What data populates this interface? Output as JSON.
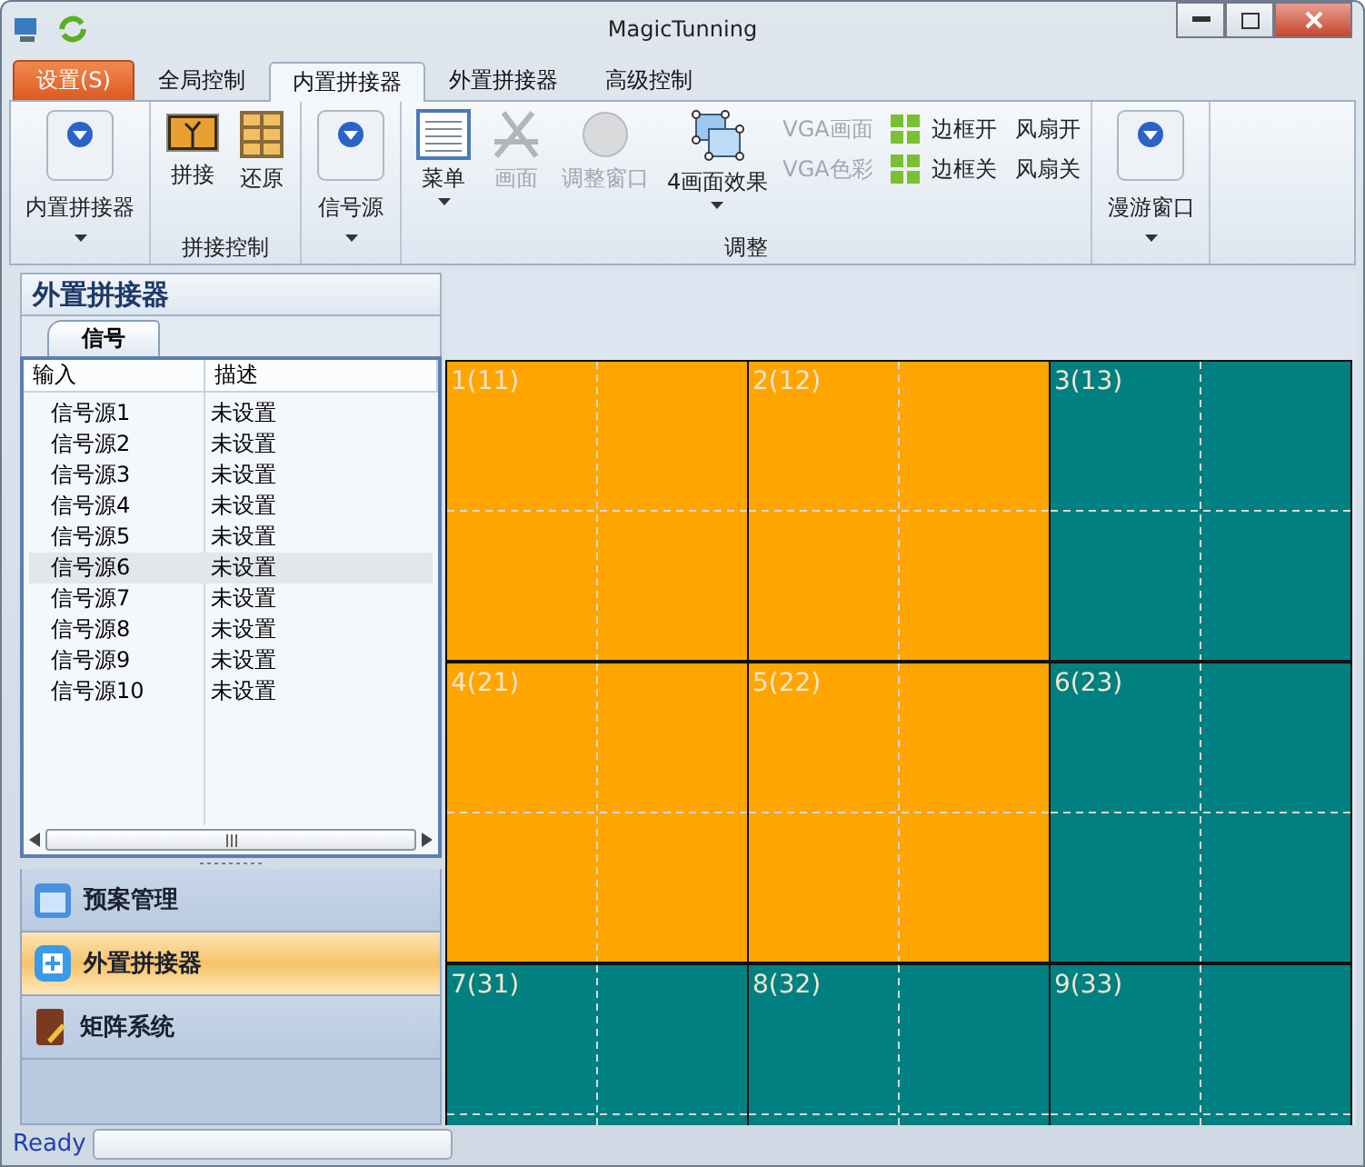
{
  "window": {
    "title": "MagicTunning"
  },
  "tabs": [
    {
      "label": "设置(S)",
      "kind": "app",
      "selected": false
    },
    {
      "label": "全局控制",
      "kind": "tab",
      "selected": false
    },
    {
      "label": "内置拼接器",
      "kind": "tab",
      "selected": true
    },
    {
      "label": "外置拼接器",
      "kind": "tab",
      "selected": false
    },
    {
      "label": "高级控制",
      "kind": "tab",
      "selected": false
    }
  ],
  "ribbon": [
    {
      "items": [
        {
          "kind": "drop",
          "label": "内置拼接器",
          "disabled": false
        }
      ]
    },
    {
      "label": "拼接控制",
      "items": [
        {
          "kind": "large",
          "label": "拼接",
          "disabled": false
        },
        {
          "kind": "large",
          "label": "还原",
          "disabled": false
        }
      ]
    },
    {
      "items": [
        {
          "kind": "drop",
          "label": "信号源",
          "disabled": false
        }
      ]
    },
    {
      "label": "调整",
      "items": [
        {
          "kind": "menu",
          "label": "菜单",
          "disabled": false
        },
        {
          "kind": "large",
          "label": "画面",
          "disabled": true
        },
        {
          "kind": "large",
          "label": "调整窗口",
          "disabled": true
        },
        {
          "kind": "menu",
          "label": "4画面效果",
          "disabled": false
        },
        {
          "kind": "small",
          "label": "VGA画面",
          "disabled": true
        },
        {
          "kind": "small",
          "label": "VGA色彩",
          "disabled": true
        },
        {
          "kind": "small",
          "label": "边框开",
          "disabled": false
        },
        {
          "kind": "small",
          "label": "边框关",
          "disabled": false
        },
        {
          "kind": "small",
          "label": "风扇开",
          "disabled": false
        },
        {
          "kind": "small",
          "label": "风扇关",
          "disabled": false
        }
      ]
    },
    {
      "items": [
        {
          "kind": "drop",
          "label": "漫游窗口",
          "disabled": false
        }
      ]
    }
  ],
  "sidebar": {
    "title": "外置拼接器",
    "tabs": [
      {
        "label": "信号",
        "selected": true
      }
    ],
    "columns": [
      "输入",
      "描述"
    ],
    "rows": [
      {
        "input": "信号源1",
        "desc": "未设置",
        "selected": false
      },
      {
        "input": "信号源2",
        "desc": "未设置",
        "selected": false
      },
      {
        "input": "信号源3",
        "desc": "未设置",
        "selected": false
      },
      {
        "input": "信号源4",
        "desc": "未设置",
        "selected": false
      },
      {
        "input": "信号源5",
        "desc": "未设置",
        "selected": false
      },
      {
        "input": "信号源6",
        "desc": "未设置",
        "selected": true
      },
      {
        "input": "信号源7",
        "desc": "未设置",
        "selected": false
      },
      {
        "input": "信号源8",
        "desc": "未设置",
        "selected": false
      },
      {
        "input": "信号源9",
        "desc": "未设置",
        "selected": false
      },
      {
        "input": "信号源10",
        "desc": "未设置",
        "selected": false
      }
    ],
    "nav": [
      {
        "label": "预案管理",
        "selected": false
      },
      {
        "label": "外置拼接器",
        "selected": true
      },
      {
        "label": "矩阵系统",
        "selected": false
      }
    ]
  },
  "wall": {
    "cells": [
      {
        "label": "1(11)",
        "color": "#ffa500"
      },
      {
        "label": "2(12)",
        "color": "#ffa500"
      },
      {
        "label": "3(13)",
        "color": "#008080"
      },
      {
        "label": "4(21)",
        "color": "#ffa500"
      },
      {
        "label": "5(22)",
        "color": "#ffa500"
      },
      {
        "label": "6(23)",
        "color": "#008080"
      },
      {
        "label": "7(31)",
        "color": "#008080"
      },
      {
        "label": "8(32)",
        "color": "#008080"
      },
      {
        "label": "9(33)",
        "color": "#008080"
      }
    ]
  },
  "status_bar": {
    "text": "Ready"
  }
}
